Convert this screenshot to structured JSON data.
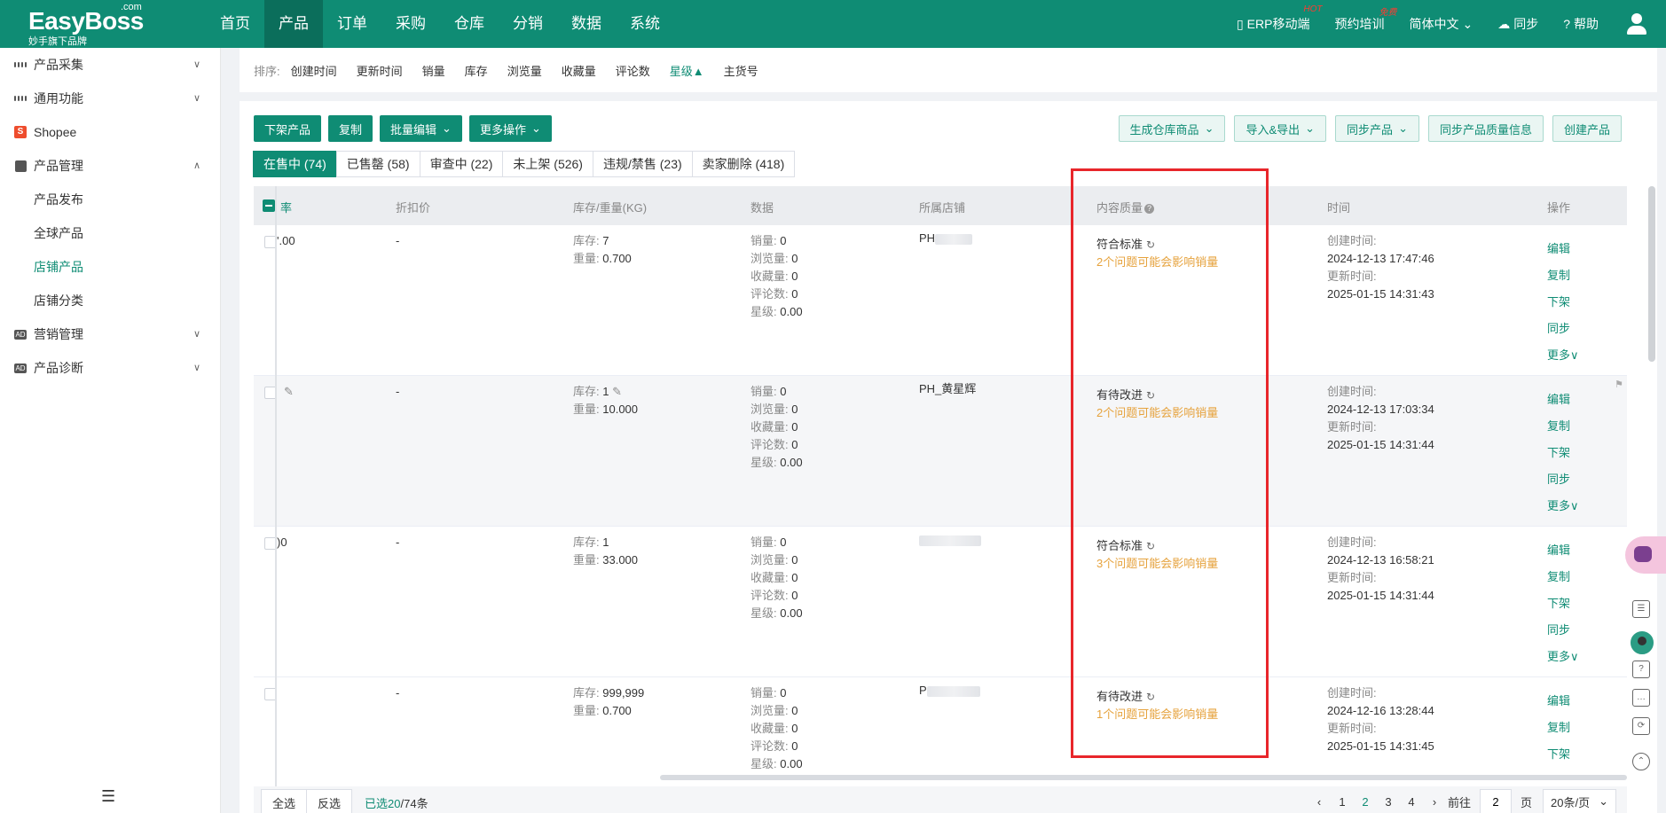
{
  "brand": {
    "name": "EasyBoss",
    "suffix": ".com",
    "tagline": "妙手旗下品牌"
  },
  "nav": [
    {
      "label": "首页"
    },
    {
      "label": "产品"
    },
    {
      "label": "订单"
    },
    {
      "label": "采购"
    },
    {
      "label": "仓库"
    },
    {
      "label": "分销"
    },
    {
      "label": "数据"
    },
    {
      "label": "系统"
    }
  ],
  "topRight": {
    "erp": "ERP移动端",
    "erp_badge": "HOT",
    "training": "预约培训",
    "training_badge": "免费",
    "lang": "简体中文",
    "sync": "同步",
    "help": "帮助"
  },
  "sidebar": {
    "items": [
      {
        "label": "产品采集"
      },
      {
        "label": "通用功能"
      },
      {
        "label": "Shopee"
      },
      {
        "label": "产品管理"
      }
    ],
    "subs": [
      {
        "label": "产品发布"
      },
      {
        "label": "全球产品"
      },
      {
        "label": "店铺产品"
      },
      {
        "label": "店铺分类"
      }
    ],
    "items2": [
      {
        "label": "营销管理"
      },
      {
        "label": "产品诊断"
      }
    ],
    "collapse": "☰"
  },
  "sort": {
    "label": "排序:",
    "options": [
      {
        "label": "创建时间"
      },
      {
        "label": "更新时间"
      },
      {
        "label": "销量"
      },
      {
        "label": "库存"
      },
      {
        "label": "浏览量"
      },
      {
        "label": "收藏量"
      },
      {
        "label": "评论数"
      },
      {
        "label": "星级▲"
      },
      {
        "label": "主货号"
      }
    ]
  },
  "actions": {
    "delist": "下架产品",
    "copy": "复制",
    "batch_edit": "批量编辑",
    "more_ops": "更多操作",
    "gen_warehouse": "生成仓库商品",
    "import_export": "导入&导出",
    "sync_products": "同步产品",
    "sync_quality": "同步产品质量信息",
    "create": "创建产品"
  },
  "tabs": [
    {
      "label": "在售中 (74)"
    },
    {
      "label": "已售罄 (58)"
    },
    {
      "label": "审查中 (22)"
    },
    {
      "label": "未上架 (526)"
    },
    {
      "label": "违规/禁售 (23)"
    },
    {
      "label": "卖家删除 (418)"
    }
  ],
  "table": {
    "headers": {
      "rate": "率",
      "discount": "折扣价",
      "stock_weight": "库存/重量(KG)",
      "data": "数据",
      "shop": "所属店铺",
      "quality": "内容质量",
      "quality_help": "?",
      "time": "时间",
      "ops": "操作"
    },
    "labels": {
      "stock": "库存:",
      "weight": "重量:",
      "sales": "销量:",
      "views": "浏览量:",
      "favs": "收藏量:",
      "reviews": "评论数:",
      "stars": "星级:",
      "created": "创建时间:",
      "updated": "更新时间:"
    },
    "ops": {
      "edit": "编辑",
      "copy": "复制",
      "delist": "下架",
      "sync": "同步",
      "more": "更多"
    },
    "rows": [
      {
        "price": "'.00",
        "discount": "-",
        "stock": "7",
        "weight": "0.700",
        "sales": "0",
        "views": "0",
        "favs": "0",
        "reviews": "0",
        "stars": "0.00",
        "shop": "PH",
        "quality": "符合标准",
        "issues": "2个问题可能会影响销量",
        "created": "2024-12-13 17:47:46",
        "updated": "2025-01-15 14:31:43"
      },
      {
        "price": "",
        "discount": "-",
        "stock": "1",
        "weight": "10.000",
        "sales": "0",
        "views": "0",
        "favs": "0",
        "reviews": "0",
        "stars": "0.00",
        "shop": "PH_黄星辉",
        "quality": "有待改进",
        "issues": "2个问题可能会影响销量",
        "created": "2024-12-13 17:03:34",
        "updated": "2025-01-15 14:31:44"
      },
      {
        "price": ")0",
        "discount": "-",
        "stock": "1",
        "weight": "33.000",
        "sales": "0",
        "views": "0",
        "favs": "0",
        "reviews": "0",
        "stars": "0.00",
        "shop": "",
        "quality": "符合标准",
        "issues": "3个问题可能会影响销量",
        "created": "2024-12-13 16:58:21",
        "updated": "2025-01-15 14:31:44"
      },
      {
        "price": "",
        "discount": "-",
        "stock": "999,999",
        "weight": "0.700",
        "sales": "0",
        "views": "0",
        "favs": "0",
        "reviews": "0",
        "stars": "0.00",
        "shop": "P",
        "quality": "有待改进",
        "issues": "1个问题可能会影响销量",
        "created": "2024-12-16 13:28:44",
        "updated": "2025-01-15 14:31:45"
      }
    ]
  },
  "footer": {
    "select_all": "全选",
    "invert": "反选",
    "selected_prefix": "已选",
    "selected_count": "20",
    "selected_total": "/74条",
    "pages": [
      "1",
      "2",
      "3",
      "4"
    ],
    "goto": "前往",
    "page_value": "2",
    "page_unit": "页",
    "page_size": "20条/页"
  }
}
